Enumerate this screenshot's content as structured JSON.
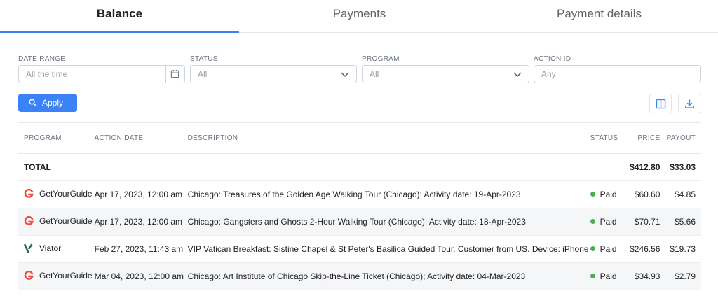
{
  "tabs": [
    {
      "label": "Balance",
      "active": true
    },
    {
      "label": "Payments",
      "active": false
    },
    {
      "label": "Payment details",
      "active": false
    }
  ],
  "filters": {
    "date_range": {
      "label": "DATE RANGE",
      "placeholder": "All the time"
    },
    "status": {
      "label": "STATUS",
      "value": "All"
    },
    "program": {
      "label": "PROGRAM",
      "value": "All"
    },
    "action_id": {
      "label": "ACTION ID",
      "placeholder": "Any"
    }
  },
  "apply_label": "Apply",
  "table": {
    "headers": {
      "program": "PROGRAM",
      "action_date": "ACTION DATE",
      "description": "DESCRIPTION",
      "status": "STATUS",
      "price": "PRICE",
      "payout": "PAYOUT"
    },
    "total": {
      "label": "TOTAL",
      "price": "$412.80",
      "payout": "$33.03"
    },
    "rows": [
      {
        "program": "GetYourGuide",
        "date": "Apr 17, 2023, 12:00 am",
        "description": "Chicago: Treasures of the Golden Age Walking Tour (Chicago); Activity date: 19-Apr-2023",
        "status": "Paid",
        "price": "$60.60",
        "payout": "$4.85"
      },
      {
        "program": "GetYourGuide",
        "date": "Apr 17, 2023, 12:00 am",
        "description": "Chicago: Gangsters and Ghosts 2-Hour Walking Tour (Chicago); Activity date: 18-Apr-2023",
        "status": "Paid",
        "price": "$70.71",
        "payout": "$5.66"
      },
      {
        "program": "Viator",
        "date": "Feb 27, 2023, 11:43 am",
        "description": "VIP Vatican Breakfast: Sistine Chapel & St Peter's Basilica Guided Tour. Customer from US. Device: iPhone",
        "status": "Paid",
        "price": "$246.56",
        "payout": "$19.73"
      },
      {
        "program": "GetYourGuide",
        "date": "Mar 04, 2023, 12:00 am",
        "description": "Chicago: Art Institute of Chicago Skip-the-Line Ticket (Chicago); Activity date: 04-Mar-2023",
        "status": "Paid",
        "price": "$34.93",
        "payout": "$2.79"
      }
    ]
  },
  "colors": {
    "accent": "#3b82f6",
    "paid": "#4caf50",
    "getyourguide": "#ef4b3f",
    "viator": "#1f6e5b"
  },
  "icons": {
    "calendar": "calendar-icon",
    "chevron": "chevron-down-icon",
    "search": "search-icon",
    "columns": "columns-icon",
    "download": "download-icon"
  }
}
